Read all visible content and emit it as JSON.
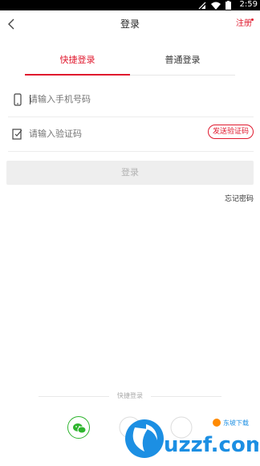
{
  "status_bar": {
    "time": "2:59"
  },
  "nav": {
    "title": "登录",
    "register": "注册"
  },
  "tabs": [
    {
      "label": "快捷登录",
      "active": true
    },
    {
      "label": "普通登录",
      "active": false
    }
  ],
  "phone_field": {
    "placeholder": "请输入手机号码",
    "value": ""
  },
  "code_field": {
    "placeholder": "请输入验证码",
    "value": ""
  },
  "send_code_label": "发送验证码",
  "login_button": "登录",
  "forgot_password": "忘记密码",
  "quick_login": {
    "label": "快捷登录",
    "providers": [
      {
        "name": "wechat",
        "icon": "wechat-icon"
      },
      {
        "name": "qq",
        "icon": "qq-icon"
      },
      {
        "name": "weibo",
        "icon": "weibo-icon"
      }
    ]
  },
  "watermark": {
    "brand": "uzzf.com",
    "tagline": "东坡下载"
  },
  "colors": {
    "accent": "#e0192e",
    "wechat": "#2fb52f",
    "button_bg": "#eeeeee"
  }
}
